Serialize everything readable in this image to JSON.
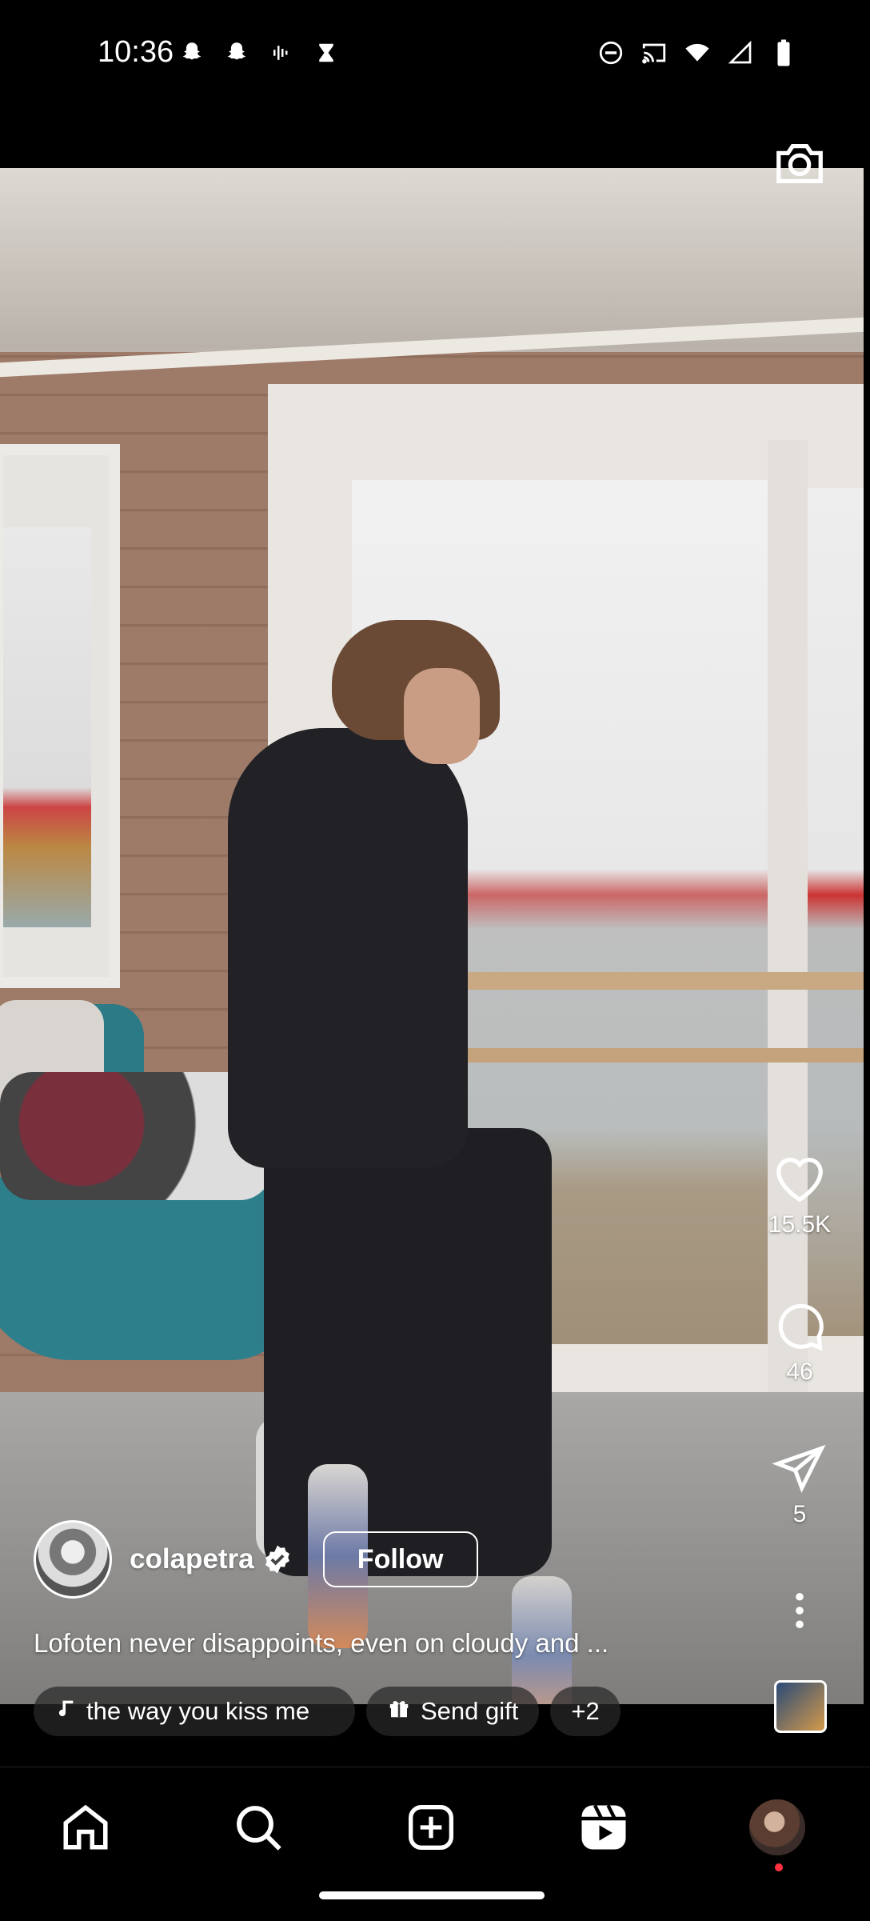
{
  "status_bar": {
    "time": "10:36",
    "left_icons": [
      "snapchat-icon",
      "snapchat-icon",
      "voice-wave-icon",
      "hourglass-icon"
    ],
    "right_icons": [
      "do-not-disturb-icon",
      "cast-icon",
      "wifi-icon",
      "signal-icon",
      "battery-icon"
    ]
  },
  "reel": {
    "likes": "15.5K",
    "comments": "46",
    "shares": "5",
    "author": {
      "username": "colapetra",
      "verified": true,
      "follow_label": "Follow"
    },
    "caption": "Lofoten never disappoints, even on cloudy and ...",
    "chips": {
      "music": "the way you kiss me",
      "gift": "Send gift",
      "more": "+2"
    }
  },
  "nav": [
    "home",
    "search",
    "create",
    "reels",
    "profile"
  ],
  "colors": {
    "background": "#000000",
    "text": "#ffffff",
    "notification": "#ff3040"
  }
}
